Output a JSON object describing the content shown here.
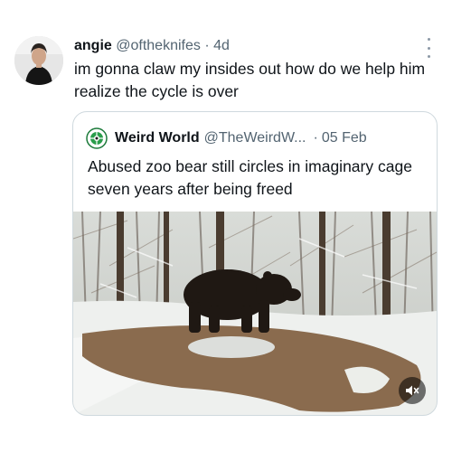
{
  "tweet": {
    "author_name": "angie",
    "author_handle": "@oftheknifes",
    "separator": "·",
    "time": "4d",
    "text": "im gonna claw my insides out how do we help him realize the cycle is over"
  },
  "quoted_tweet": {
    "author_name": "Weird World",
    "author_handle": "@TheWeirdW...",
    "separator": "·",
    "time": "05 Feb",
    "text": "Abused zoo bear still circles in imaginary cage seven years after being freed"
  },
  "icons": {
    "more": "more-options-icon",
    "mute": "volume-muted-icon",
    "quoted_avatar": "globe-logo-icon"
  },
  "colors": {
    "name": "#0f1419",
    "secondary": "#536471",
    "border": "#cfd9de"
  }
}
